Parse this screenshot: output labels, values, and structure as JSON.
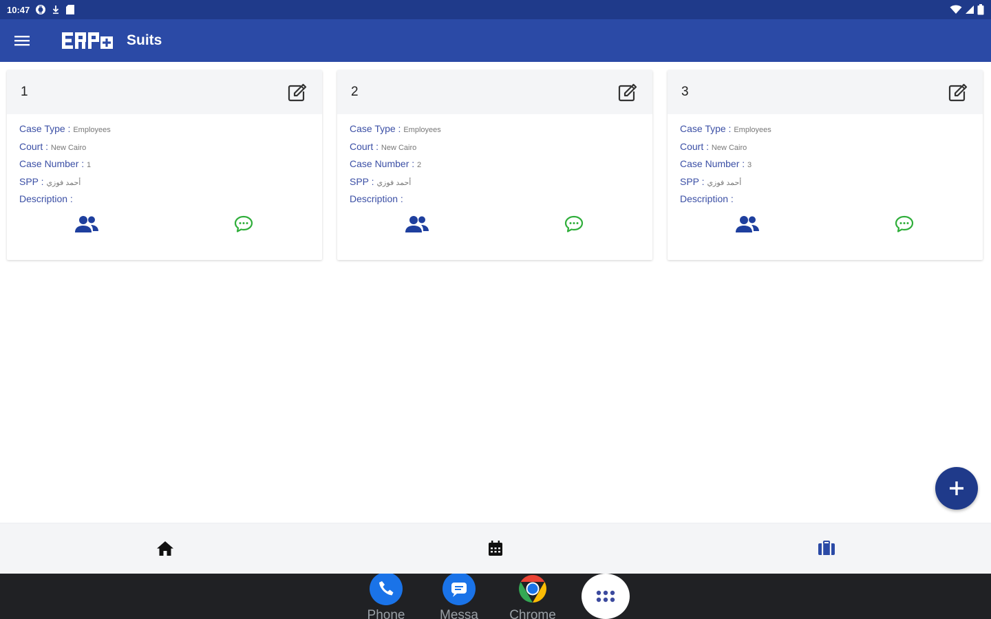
{
  "status_bar": {
    "time": "10:47",
    "left_icons": [
      "settings-badge-icon",
      "download-icon",
      "sd-card-icon"
    ],
    "right_icons": [
      "wifi-icon",
      "signal-icon",
      "battery-icon"
    ]
  },
  "app_bar": {
    "logo_text": "ERP",
    "title": "Suits",
    "menu_icon": "hamburger-menu-icon"
  },
  "cards": [
    {
      "number": "1",
      "fields": [
        {
          "label": "Case Type",
          "sep": " : ",
          "value": "Employees"
        },
        {
          "label": "Court",
          "sep": " : ",
          "value": "New Cairo"
        },
        {
          "label": "Case Number",
          "sep": " : ",
          "value": "1"
        },
        {
          "label": "SPP",
          "sep": " : ",
          "value": "أحمد فوزي"
        },
        {
          "label": "Description",
          "sep": " : ",
          "value": ""
        }
      ]
    },
    {
      "number": "2",
      "fields": [
        {
          "label": "Case Type",
          "sep": " : ",
          "value": "Employees"
        },
        {
          "label": "Court",
          "sep": " : ",
          "value": "New Cairo"
        },
        {
          "label": "Case Number",
          "sep": " : ",
          "value": "2"
        },
        {
          "label": "SPP",
          "sep": " : ",
          "value": "أحمد فوزي"
        },
        {
          "label": "Description",
          "sep": " : ",
          "value": ""
        }
      ]
    },
    {
      "number": "3",
      "fields": [
        {
          "label": "Case Type",
          "sep": " : ",
          "value": "Employees"
        },
        {
          "label": "Court",
          "sep": " : ",
          "value": "New Cairo"
        },
        {
          "label": "Case Number",
          "sep": " : ",
          "value": "3"
        },
        {
          "label": "SPP",
          "sep": " : ",
          "value": "أحمد فوزي"
        },
        {
          "label": "Description",
          "sep": " : ",
          "value": ""
        }
      ]
    }
  ],
  "colors": {
    "primary": "#2b4aa6",
    "status_bar": "#1f3a8a",
    "chat_green": "#2fae3a",
    "people_blue": "#1e3f9e"
  },
  "bottom_nav": {
    "items": [
      {
        "icon": "home-icon"
      },
      {
        "icon": "calendar-icon"
      },
      {
        "icon": "briefcase-icon"
      }
    ],
    "active_index": 2
  },
  "dock": {
    "apps": [
      {
        "label": "Phone",
        "icon": "phone-icon"
      },
      {
        "label": "Messa",
        "icon": "messages-icon"
      },
      {
        "label": "Chrome",
        "icon": "chrome-icon"
      }
    ],
    "apps_button_icon": "app-drawer-icon"
  }
}
